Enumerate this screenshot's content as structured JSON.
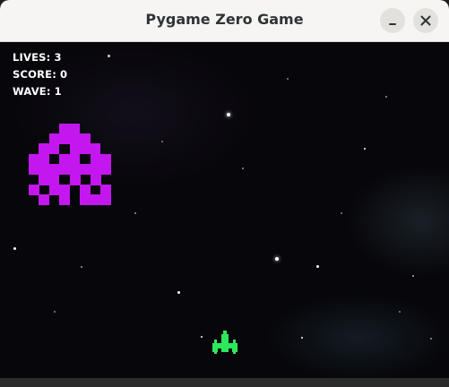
{
  "window": {
    "title": "Pygame Zero Game",
    "minimize_icon": "minimize-icon",
    "close_icon": "close-icon"
  },
  "hud": {
    "lives_label": "LIVES:",
    "lives": "3",
    "score_label": "SCORE:",
    "score": "0",
    "wave_label": "WAVE:",
    "wave": "1"
  },
  "sprites": {
    "alien": {
      "icon": "space-invader-alien",
      "color": "#c417f0"
    },
    "player": {
      "icon": "player-spaceship",
      "color": "#2de85a"
    }
  },
  "colors": {
    "background": "#07060a",
    "hud_text": "#ffffff",
    "titlebar": "#f6f5f4"
  }
}
